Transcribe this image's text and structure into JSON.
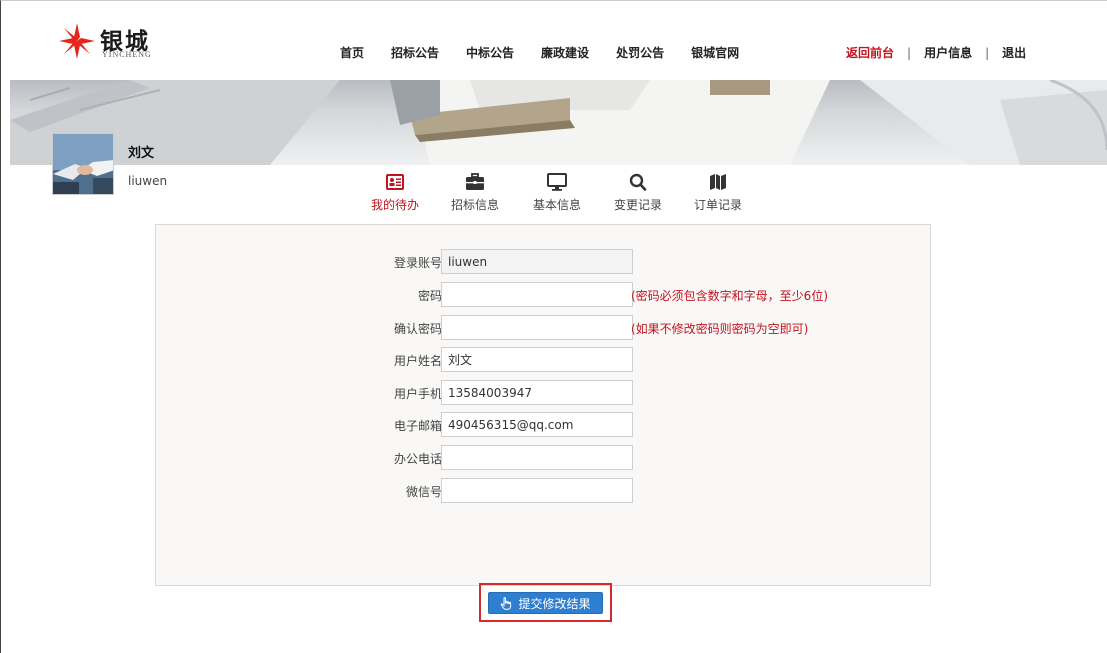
{
  "header": {
    "logo_brand": "银城",
    "logo_sub": "YINCHENG",
    "nav": [
      "首页",
      "招标公告",
      "中标公告",
      "廉政建设",
      "处罚公告",
      "银城官网"
    ],
    "back_label": "返回前台",
    "user_info_label": "用户信息",
    "logout_label": "退出"
  },
  "profile": {
    "name": "刘文",
    "account": "liuwen"
  },
  "tabs": [
    {
      "label": "我的待办",
      "icon": "todo-card-icon",
      "active": true
    },
    {
      "label": "招标信息",
      "icon": "briefcase-icon",
      "active": false
    },
    {
      "label": "基本信息",
      "icon": "monitor-icon",
      "active": false
    },
    {
      "label": "变更记录",
      "icon": "search-icon",
      "active": false
    },
    {
      "label": "订单记录",
      "icon": "map-icon",
      "active": false
    }
  ],
  "form": {
    "account_label": "登录账号",
    "account_value": "liuwen",
    "password_label": "密码",
    "password_value": "",
    "password_hint": "(密码必须包含数字和字母，至少6位)",
    "confirm_label": "确认密码",
    "confirm_value": "",
    "confirm_hint": "(如果不修改密码则密码为空即可)",
    "name_label": "用户姓名",
    "name_value": "刘文",
    "phone_label": "用户手机",
    "phone_value": "13584003947",
    "email_label": "电子邮箱",
    "email_value": "490456315@qq.com",
    "office_label": "办公电话",
    "office_value": "",
    "wechat_label": "微信号",
    "wechat_value": ""
  },
  "submit_label": "提交修改结果",
  "colors": {
    "accent_red": "#c0141f",
    "button_blue": "#2f7fd0",
    "highlight_outline": "#d62a2a",
    "logo_red": "#e4261c"
  }
}
